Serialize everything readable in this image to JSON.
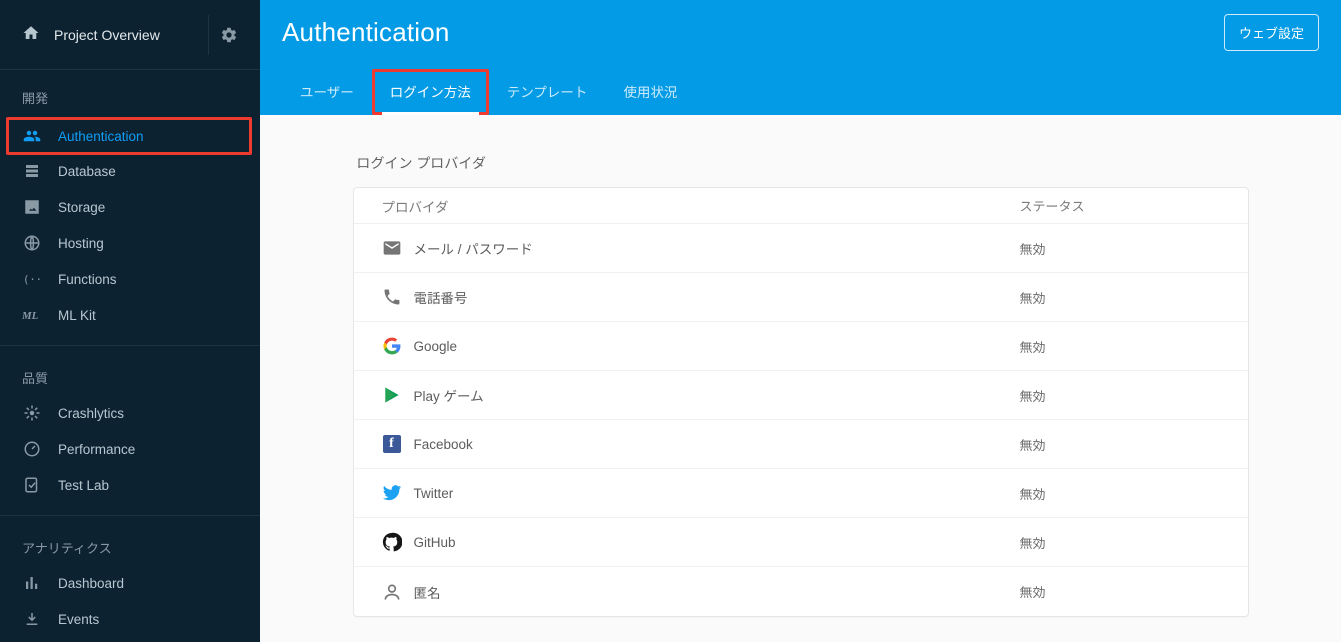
{
  "sidebar": {
    "overview_label": "Project Overview",
    "sections": [
      {
        "label": "開発",
        "items": [
          {
            "icon": "people-icon",
            "label": "Authentication",
            "active": true,
            "highlight": true
          },
          {
            "icon": "database-icon",
            "label": "Database"
          },
          {
            "icon": "storage-icon",
            "label": "Storage"
          },
          {
            "icon": "hosting-icon",
            "label": "Hosting"
          },
          {
            "icon": "functions-icon",
            "label": "Functions"
          },
          {
            "icon": "mlkit-icon",
            "label": "ML Kit"
          }
        ]
      },
      {
        "label": "品質",
        "items": [
          {
            "icon": "crashlytics-icon",
            "label": "Crashlytics"
          },
          {
            "icon": "performance-icon",
            "label": "Performance"
          },
          {
            "icon": "testlab-icon",
            "label": "Test Lab"
          }
        ]
      },
      {
        "label": "アナリティクス",
        "items": [
          {
            "icon": "dashboard-icon",
            "label": "Dashboard"
          },
          {
            "icon": "events-icon",
            "label": "Events"
          }
        ]
      }
    ]
  },
  "header": {
    "title": "Authentication",
    "setup_button": "ウェブ設定",
    "tabs": [
      {
        "label": "ユーザー"
      },
      {
        "label": "ログイン方法",
        "active": true,
        "highlight": true
      },
      {
        "label": "テンプレート"
      },
      {
        "label": "使用状況"
      }
    ]
  },
  "content": {
    "section_title": "ログイン プロバイダ",
    "columns": {
      "provider": "プロバイダ",
      "status": "ステータス"
    },
    "providers": [
      {
        "icon": "mail-icon",
        "label": "メール / パスワード",
        "status": "無効"
      },
      {
        "icon": "phone-icon",
        "label": "電話番号",
        "status": "無効"
      },
      {
        "icon": "google-icon",
        "label": "Google",
        "status": "無効"
      },
      {
        "icon": "playgames-icon",
        "label": "Play ゲーム",
        "status": "無効"
      },
      {
        "icon": "facebook-icon",
        "label": "Facebook",
        "status": "無効"
      },
      {
        "icon": "twitter-icon",
        "label": "Twitter",
        "status": "無効"
      },
      {
        "icon": "github-icon",
        "label": "GitHub",
        "status": "無効"
      },
      {
        "icon": "anonymous-icon",
        "label": "匿名",
        "status": "無効"
      }
    ]
  }
}
